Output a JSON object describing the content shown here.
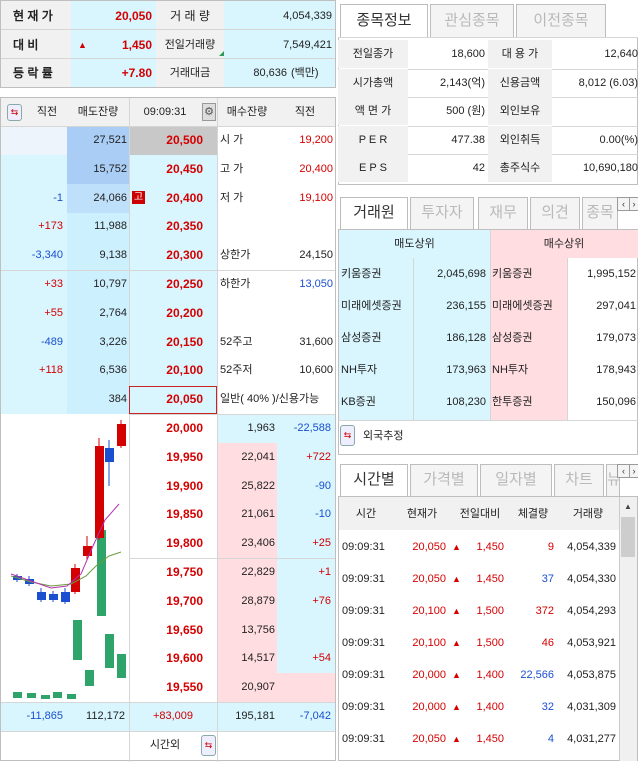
{
  "summary": {
    "rows": [
      {
        "label": "현 재 가",
        "value": "20,050",
        "label2": "거 래 량",
        "value2": "4,054,339"
      },
      {
        "label": "대  비",
        "value": "1,450",
        "label2": "전일거래량",
        "value2": "7,549,421"
      },
      {
        "label": "등 락 률",
        "value": "+7.80",
        "label2": "거래대금",
        "value2": "80,636",
        "unit": "(백만)"
      }
    ]
  },
  "orderbook": {
    "headers": {
      "prev": "직전",
      "ask_qty": "매도잔량",
      "time": "09:09:31",
      "bid_qty": "매수잔량",
      "prev2": "직전"
    },
    "ask_rows": [
      {
        "prev": "",
        "qty": "27,521",
        "price": "20,500",
        "info_label": "시  가",
        "info_value": "19,200"
      },
      {
        "prev": "",
        "qty": "15,752",
        "price": "20,450",
        "info_label": "고  가",
        "info_value": "20,400"
      },
      {
        "prev": "-1",
        "qty": "24,066",
        "price": "20,400",
        "info_label": "저  가",
        "info_value": "19,100",
        "badge": "고"
      },
      {
        "prev": "+173",
        "qty": "11,988",
        "price": "20,350",
        "info_label": "",
        "info_value": ""
      },
      {
        "prev": "-3,340",
        "qty": "9,138",
        "price": "20,300",
        "info_label": "상한가",
        "info_value": "24,150"
      },
      {
        "prev": "+33",
        "qty": "10,797",
        "price": "20,250",
        "info_label": "하한가",
        "info_value": "13,050"
      },
      {
        "prev": "+55",
        "qty": "2,764",
        "price": "20,200",
        "info_label": "",
        "info_value": ""
      },
      {
        "prev": "-489",
        "qty": "3,226",
        "price": "20,150",
        "info_label": "52주고",
        "info_value": "31,600"
      },
      {
        "prev": "+118",
        "qty": "6,536",
        "price": "20,100",
        "info_label": "52주저",
        "info_value": "10,600"
      },
      {
        "prev": "",
        "qty": "384",
        "price": "20,050",
        "info_label": "일반( 40% )/신용가능",
        "info_value": ""
      }
    ],
    "bid_rows": [
      {
        "price": "20,000",
        "qty": "1,963",
        "prev": "-22,588"
      },
      {
        "price": "19,950",
        "qty": "22,041",
        "prev": "+722"
      },
      {
        "price": "19,900",
        "qty": "25,822",
        "prev": "-90"
      },
      {
        "price": "19,850",
        "qty": "21,061",
        "prev": "-10"
      },
      {
        "price": "19,800",
        "qty": "23,406",
        "prev": "+25"
      },
      {
        "price": "19,750",
        "qty": "22,829",
        "prev": "+1"
      },
      {
        "price": "19,700",
        "qty": "28,879",
        "prev": "+76"
      },
      {
        "price": "19,650",
        "qty": "13,756",
        "prev": ""
      },
      {
        "price": "19,600",
        "qty": "14,517",
        "prev": "+54"
      },
      {
        "price": "19,550",
        "qty": "20,907",
        "prev": ""
      }
    ],
    "totals": {
      "ask_prev": "-11,865",
      "ask_total": "112,172",
      "diff": "+83,009",
      "bid_total": "195,181",
      "bid_prev": "-7,042"
    },
    "footer_label": "시간외"
  },
  "top_tabs": [
    "종목정보",
    "관심종목",
    "이전종목"
  ],
  "stock_info": [
    {
      "l1": "전일종가",
      "v1": "18,600",
      "l2": "대 용 가",
      "v2": "12,640"
    },
    {
      "l1": "시가총액",
      "v1": "2,143(억)",
      "l2": "신용금액",
      "v2": "8,012 (6.03)"
    },
    {
      "l1": "액 면 가",
      "v1": "500 (원)",
      "l2": "외인보유",
      "v2": ""
    },
    {
      "l1": "P E R",
      "v1": "477.38",
      "l2": "외인취득",
      "v2": "0.00(%)"
    },
    {
      "l1": "E P S",
      "v1": "42",
      "l2": "총주식수",
      "v2": "10,690,180"
    }
  ],
  "mid_tabs": [
    "거래원",
    "투자자",
    "재무",
    "의견",
    "종목"
  ],
  "brokers": {
    "sell_header": "매도상위",
    "buy_header": "매수상위",
    "rows": [
      {
        "s": "키움증권",
        "sv": "2,045,698",
        "b": "키움증권",
        "bv": "1,995,152"
      },
      {
        "s": "미래에셋증권",
        "sv": "236,155",
        "b": "미래에셋증권",
        "bv": "297,041"
      },
      {
        "s": "삼성증권",
        "sv": "186,128",
        "b": "삼성증권",
        "bv": "179,073"
      },
      {
        "s": "NH투자",
        "sv": "173,963",
        "b": "NH투자",
        "bv": "178,943"
      },
      {
        "s": "KB증권",
        "sv": "108,230",
        "b": "한투증권",
        "bv": "150,096"
      }
    ],
    "foreign_label": "외국추정"
  },
  "bottom_tabs": [
    "시간별",
    "가격별",
    "일자별",
    "차트",
    "뉴"
  ],
  "ticks": {
    "headers": [
      "시간",
      "현재가",
      "전일대비",
      "체결량",
      "거래량"
    ],
    "rows": [
      {
        "t": "09:09:31",
        "p": "20,050",
        "c": "1,450",
        "q": "9",
        "v": "4,054,339"
      },
      {
        "t": "09:09:31",
        "p": "20,050",
        "c": "1,450",
        "q": "37",
        "v": "4,054,330"
      },
      {
        "t": "09:09:31",
        "p": "20,100",
        "c": "1,500",
        "q": "372",
        "v": "4,054,293"
      },
      {
        "t": "09:09:31",
        "p": "20,100",
        "c": "1,500",
        "q": "46",
        "v": "4,053,921"
      },
      {
        "t": "09:09:31",
        "p": "20,000",
        "c": "1,400",
        "q": "22,566",
        "v": "4,053,875"
      },
      {
        "t": "09:09:31",
        "p": "20,000",
        "c": "1,400",
        "q": "32",
        "v": "4,031,309"
      },
      {
        "t": "09:09:31",
        "p": "20,050",
        "c": "1,450",
        "q": "4",
        "v": "4,031,277"
      }
    ]
  },
  "colors": {
    "up": "#d40000",
    "down": "#1a4fd0",
    "cyan": "#d9f6ff",
    "gray": "#f1f1f1",
    "pink": "#ffdde0",
    "vol": "#2ea36a"
  }
}
